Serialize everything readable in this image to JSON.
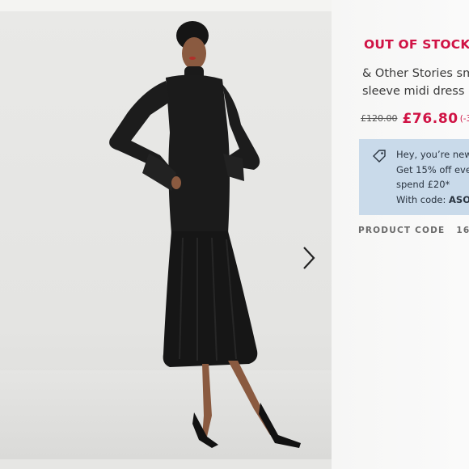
{
  "product": {
    "stock_status": "OUT OF STOCK",
    "name_line1": "& Other Stories sm",
    "name_line2": "sleeve midi dress i",
    "price_old": "£120.00",
    "price_new": "£76.80",
    "price_discount": "(-3"
  },
  "promo": {
    "icon": "tag-icon",
    "line1": "Hey, you’re new",
    "line2": "Get 15% off eve",
    "line3": "spend £20*",
    "line4_prefix": "With code: ",
    "line4_code": "ASO"
  },
  "product_code": {
    "label": "PRODUCT CODE",
    "value": "161"
  },
  "gallery": {
    "next_icon": "chevron-right-icon"
  },
  "colors": {
    "accent_red": "#d01345",
    "promo_blue": "#c9daea"
  }
}
